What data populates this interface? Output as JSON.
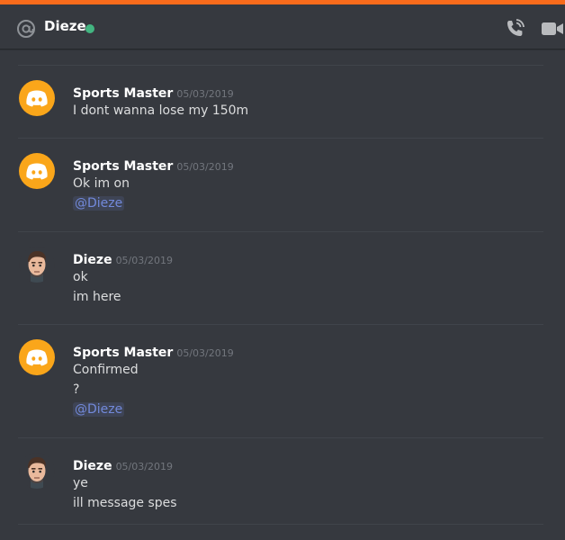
{
  "colors": {
    "accent_top": "#f96b1b",
    "discord_yellow": "#faa61a",
    "online_green": "#43b581",
    "mention_blue": "#7289da"
  },
  "header": {
    "icon": "at-icon",
    "title": "Dieze",
    "status": "online",
    "actions": [
      "voice-call-icon",
      "video-call-icon"
    ]
  },
  "messages": [
    {
      "author": "Sports Master",
      "avatar": "discord-default-avatar",
      "timestamp": "05/03/2019",
      "lines": [
        "I dont wanna lose my 150m"
      ]
    },
    {
      "author": "Sports Master",
      "avatar": "discord-default-avatar",
      "timestamp": "05/03/2019",
      "lines": [
        "Ok im on"
      ],
      "mention": "@Dieze"
    },
    {
      "author": "Dieze",
      "avatar": "cartoon-face-avatar",
      "timestamp": "05/03/2019",
      "lines": [
        "ok",
        "im here"
      ]
    },
    {
      "author": "Sports Master",
      "avatar": "discord-default-avatar",
      "timestamp": "05/03/2019",
      "lines": [
        "Confirmed",
        "?"
      ],
      "mention": "@Dieze"
    },
    {
      "author": "Dieze",
      "avatar": "cartoon-face-avatar",
      "timestamp": "05/03/2019",
      "lines": [
        "ye",
        "ill message spes"
      ]
    }
  ]
}
